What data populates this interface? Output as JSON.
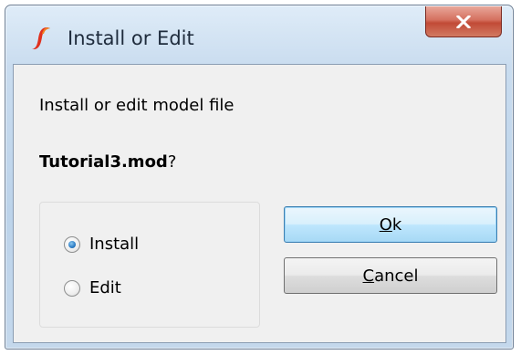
{
  "window": {
    "title": "Install or Edit",
    "close_glyph": "X"
  },
  "dialog": {
    "prompt": "Install or edit model file",
    "filename": "Tutorial3.mod",
    "question_mark": "?"
  },
  "options": {
    "selected": "Install",
    "items": [
      {
        "label": "Install",
        "checked": true
      },
      {
        "label": "Edit",
        "checked": false
      }
    ]
  },
  "buttons": {
    "ok": {
      "mnemonic": "O",
      "rest": "k"
    },
    "cancel": {
      "mnemonic": "C",
      "rest": "ancel"
    }
  },
  "colors": {
    "accent": "#3c7fb1",
    "close_button": "#c14a36",
    "app_icon": "#e0301e"
  },
  "icons": {
    "app": "simetrix-logo-icon",
    "close": "close-icon"
  }
}
